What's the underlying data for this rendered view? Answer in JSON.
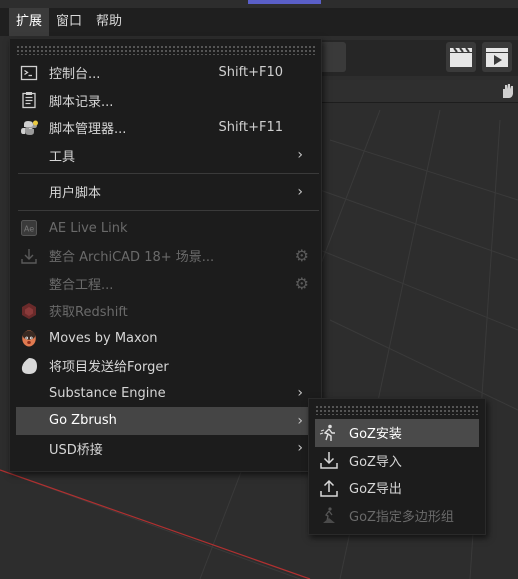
{
  "menubar": {
    "items": [
      {
        "label": "扩展"
      },
      {
        "label": "窗口"
      },
      {
        "label": "帮助"
      }
    ]
  },
  "menu": {
    "items": [
      {
        "label": "控制台...",
        "shortcut": "Shift+F10",
        "icon": "console-icon"
      },
      {
        "label": "脚本记录...",
        "icon": "script-log-icon"
      },
      {
        "label": "脚本管理器...",
        "shortcut": "Shift+F11",
        "icon": "python-icon"
      },
      {
        "label": "工具"
      },
      {
        "label": "用户脚本"
      },
      {
        "label": "AE Live Link",
        "icon": "ae-icon"
      },
      {
        "label": "整合 ArchiCAD 18+ 场景...",
        "icon": "download-icon"
      },
      {
        "label": "整合工程..."
      },
      {
        "label": "获取Redshift",
        "icon": "redshift-icon"
      },
      {
        "label": "Moves by Maxon",
        "icon": "moves-face-icon"
      },
      {
        "label": "将项目发送给Forger",
        "icon": "forger-icon"
      },
      {
        "label": "Substance Engine"
      },
      {
        "label": "Go Zbrush"
      },
      {
        "label": "USD桥接"
      }
    ]
  },
  "submenu": {
    "items": [
      {
        "label": "GoZ安装",
        "icon": "goz-install-icon"
      },
      {
        "label": "GoZ导入",
        "icon": "import-icon"
      },
      {
        "label": "GoZ导出",
        "icon": "export-icon"
      },
      {
        "label": "GoZ指定多边形组",
        "icon": "goz-polygroup-icon"
      }
    ]
  },
  "colors": {
    "menu_bg": "#1c1c1c",
    "highlight": "#454545",
    "disabled_text": "#6a6a6a",
    "grid_red_line": "#b03030"
  }
}
